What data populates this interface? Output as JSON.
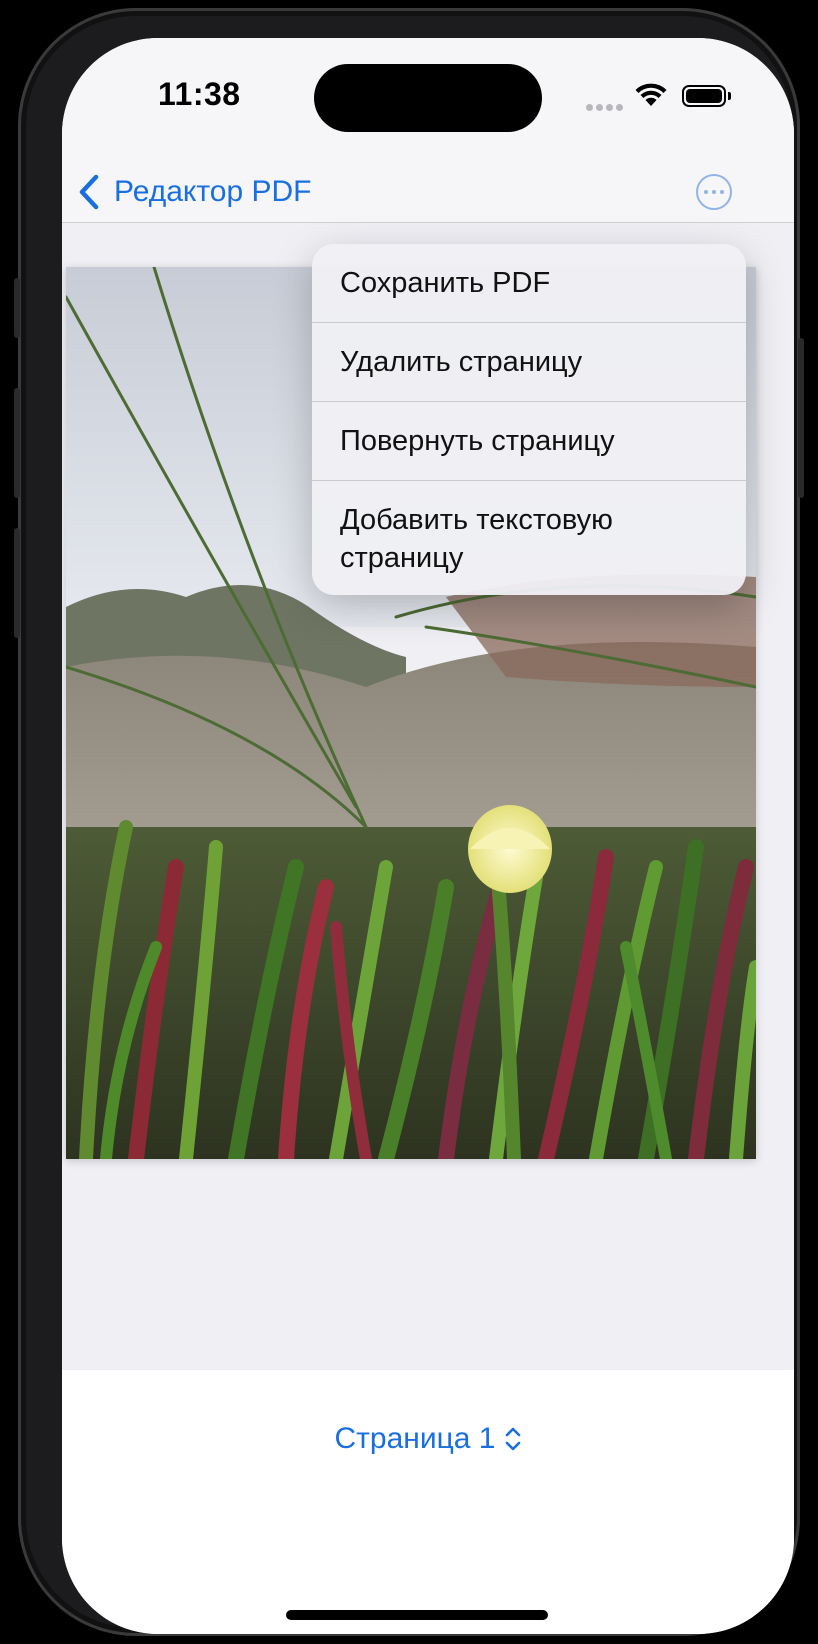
{
  "status_bar": {
    "time": "11:38"
  },
  "nav": {
    "back_label": "Редактор PDF",
    "more_icon": "ellipsis-circle-icon"
  },
  "menu": {
    "items": [
      {
        "label": "Сохранить PDF"
      },
      {
        "label": "Удалить страницу"
      },
      {
        "label": "Повернуть страницу"
      },
      {
        "label": "Добавить текстовую страницу"
      }
    ]
  },
  "footer": {
    "page_label": "Страница 1",
    "picker_icon": "chevron-up-down-icon"
  },
  "colors": {
    "accent": "#1a6fe0",
    "menu_bg": "#f0f0f4",
    "screen_bg": "#efeff4"
  }
}
